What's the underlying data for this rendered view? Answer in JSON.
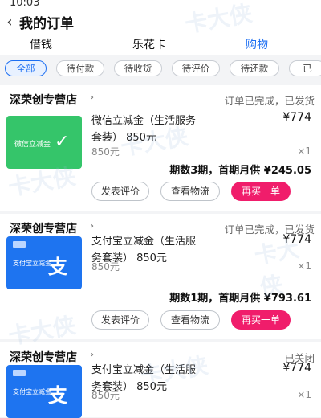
{
  "status_time": "10:03",
  "header": {
    "back_icon": "chevron-left-icon",
    "title": "我的订单"
  },
  "tabs": [
    {
      "label": "借钱",
      "active": false
    },
    {
      "label": "乐花卡",
      "active": false
    },
    {
      "label": "购物",
      "active": true
    }
  ],
  "filter_chips": [
    {
      "label": "全部",
      "active": true
    },
    {
      "label": "待付款",
      "active": false
    },
    {
      "label": "待收货",
      "active": false
    },
    {
      "label": "待评价",
      "active": false
    },
    {
      "label": "待还款",
      "active": false
    },
    {
      "label": "已",
      "active": false
    }
  ],
  "orders": [
    {
      "store": "深荣创专营店",
      "status": "订单已完成，已发货",
      "product": "微信立减金（生活服务套装）850元",
      "product_line1": "微信立减金（生活服务",
      "product_line2": "套装） 850元",
      "price": "¥774",
      "subprice": "850元",
      "qty": "×1",
      "summary": "期数3期，首期月供 ¥245.05",
      "thumb_type": "wechat",
      "thumb_text": "微信立减金",
      "buttons": [
        "发表评价",
        "查看物流",
        "再买一单"
      ]
    },
    {
      "store": "深荣创专营店",
      "status": "订单已完成，已发货",
      "product_line1": "支付宝立减金（生活服",
      "product_line2": "务套装） 850元",
      "price": "¥774",
      "subprice": "850元",
      "qty": "×1",
      "summary": "期数1期，首期月供 ¥793.61",
      "thumb_type": "alipay",
      "thumb_text": "支付宝立减金",
      "buttons": [
        "发表评价",
        "查看物流",
        "再买一单"
      ]
    },
    {
      "store": "深荣创专营店",
      "status": "已关闭",
      "product_line1": "支付宝立减金（生活服",
      "product_line2": "务套装） 850元",
      "price": "¥774",
      "subprice": "850元",
      "qty": "×1",
      "thumb_type": "alipay",
      "thumb_text": "支付宝立减金"
    }
  ],
  "watermark": "卡大侠",
  "watermark_url": "www.kadaxia.com",
  "colors": {
    "accent": "#1d6ff2",
    "primary_button": "#f01d6b",
    "wechat_green": "#35c56a",
    "alipay_blue": "#1e74f0"
  }
}
